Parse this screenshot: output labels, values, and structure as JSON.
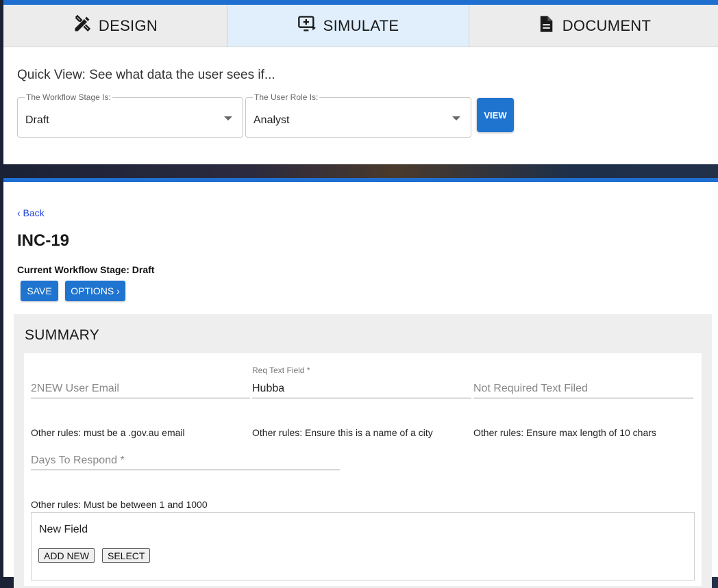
{
  "tabs": [
    {
      "label": "DESIGN",
      "icon": "design-tools-icon",
      "active": false
    },
    {
      "label": "SIMULATE",
      "icon": "simulate-screen-icon",
      "active": true
    },
    {
      "label": "DOCUMENT",
      "icon": "document-icon",
      "active": false
    }
  ],
  "quick_view": {
    "title": "Quick View: See what data the user sees if...",
    "stage_label": "The Workflow Stage Is:",
    "stage_value": "Draft",
    "role_label": "The User Role Is:",
    "role_value": "Analyst",
    "view_button": "VIEW"
  },
  "record": {
    "back_link": "‹ Back",
    "title": "INC-19",
    "stage_line": "Current Workflow Stage: Draft",
    "save_button": "SAVE",
    "options_button": "OPTIONS ›"
  },
  "summary": {
    "title": "SUMMARY",
    "fields": [
      {
        "placeholder": "2NEW User Email",
        "label": "",
        "value": "",
        "rule": "Other rules: must be a .gov.au email"
      },
      {
        "placeholder": "",
        "label": "Req Text Field *",
        "value": "Hubba",
        "rule": "Other rules: Ensure this is a name of a city"
      },
      {
        "placeholder": "Not Required Text Filed",
        "label": "",
        "value": "",
        "rule": "Other rules: Ensure max length of 10 chars"
      },
      {
        "placeholder": "Days To Respond *",
        "label": "",
        "value": "",
        "rule": "Other rules: Must be between 1 and 1000"
      }
    ],
    "new_field": {
      "title": "New Field",
      "add_button": "ADD NEW",
      "select_button": "SELECT"
    }
  },
  "colors": {
    "accent": "#1f74d0",
    "active_tab": "#e0effb",
    "link": "#1f3fd8"
  }
}
